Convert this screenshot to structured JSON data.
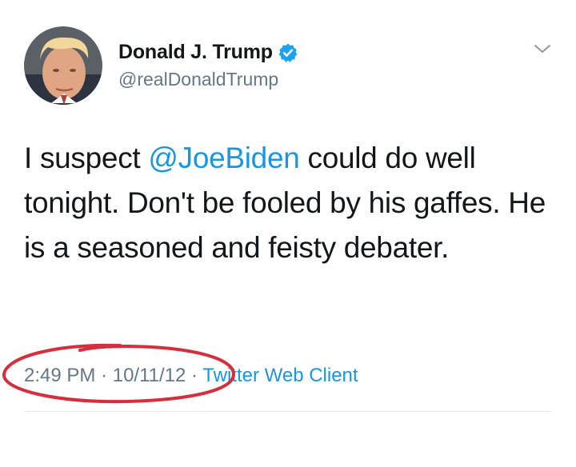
{
  "tweet": {
    "author": {
      "display_name": "Donald J. Trump",
      "handle": "@realDonaldTrump",
      "verified": true,
      "avatar_icon": "profile-photo"
    },
    "text": {
      "before_mention": "I suspect ",
      "mention": "@JoeBiden",
      "after_mention": " could do well tonight. Don't be fooled by his gaffes. He is a seasoned and feisty debater."
    },
    "time": "2:49 PM",
    "separator": "·",
    "date": "10/11/12",
    "source": "Twitter Web Client"
  },
  "icons": {
    "verified": "verified-badge-icon",
    "menu": "chevron-down-icon"
  },
  "colors": {
    "link": "#1b95e0",
    "secondary_text": "#657786",
    "verified": "#1da1f2",
    "annotation": "#d32f3c"
  }
}
